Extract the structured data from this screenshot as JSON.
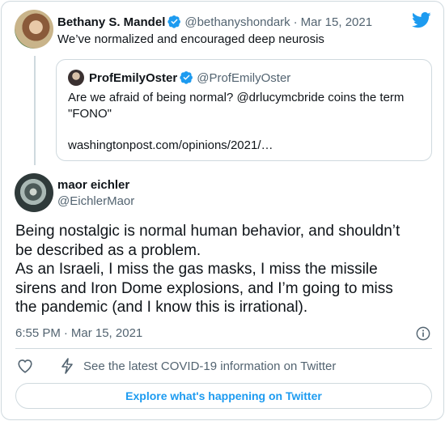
{
  "parent_tweet": {
    "author_name": "Bethany S. Mandel",
    "author_handle": "@bethanyshondark",
    "date_separator": "·",
    "date": "Mar 15, 2021",
    "text": "We’ve normalized and encouraged deep neurosis"
  },
  "quoted_tweet": {
    "author_name": "ProfEmilyOster",
    "author_handle": "@ProfEmilyOster",
    "text_line1": "Are we afraid of being normal? @drlucymcbride coins the term",
    "text_line2": "\"FONO\"",
    "link": "washingtonpost.com/opinions/2021/…"
  },
  "main_tweet": {
    "author_name": "maor eichler",
    "author_handle": "@EichlerMaor",
    "text_lines": [
      "Being nostalgic is normal human behavior, and shouldn’t",
      "be described as a problem.",
      "As an Israeli, I miss the gas masks, I miss the missile",
      "sirens and Iron Dome explosions, and I’m going to miss",
      "the pandemic (and I know this is irrational)."
    ],
    "time": "6:55 PM",
    "date_separator": "·",
    "date": "Mar 15, 2021"
  },
  "actions": {
    "covid_label": "See the latest COVID-19 information on Twitter",
    "explore_label": "Explore what's happening on Twitter"
  },
  "icons": {
    "logo": "twitter-bird-icon",
    "verified": "verified-badge-icon",
    "info": "info-icon",
    "like": "heart-icon",
    "covid": "lightning-icon"
  },
  "colors": {
    "brand": "#1d9bf0",
    "text": "#0f1419",
    "secondary": "#536471",
    "border": "#cfd9de"
  }
}
